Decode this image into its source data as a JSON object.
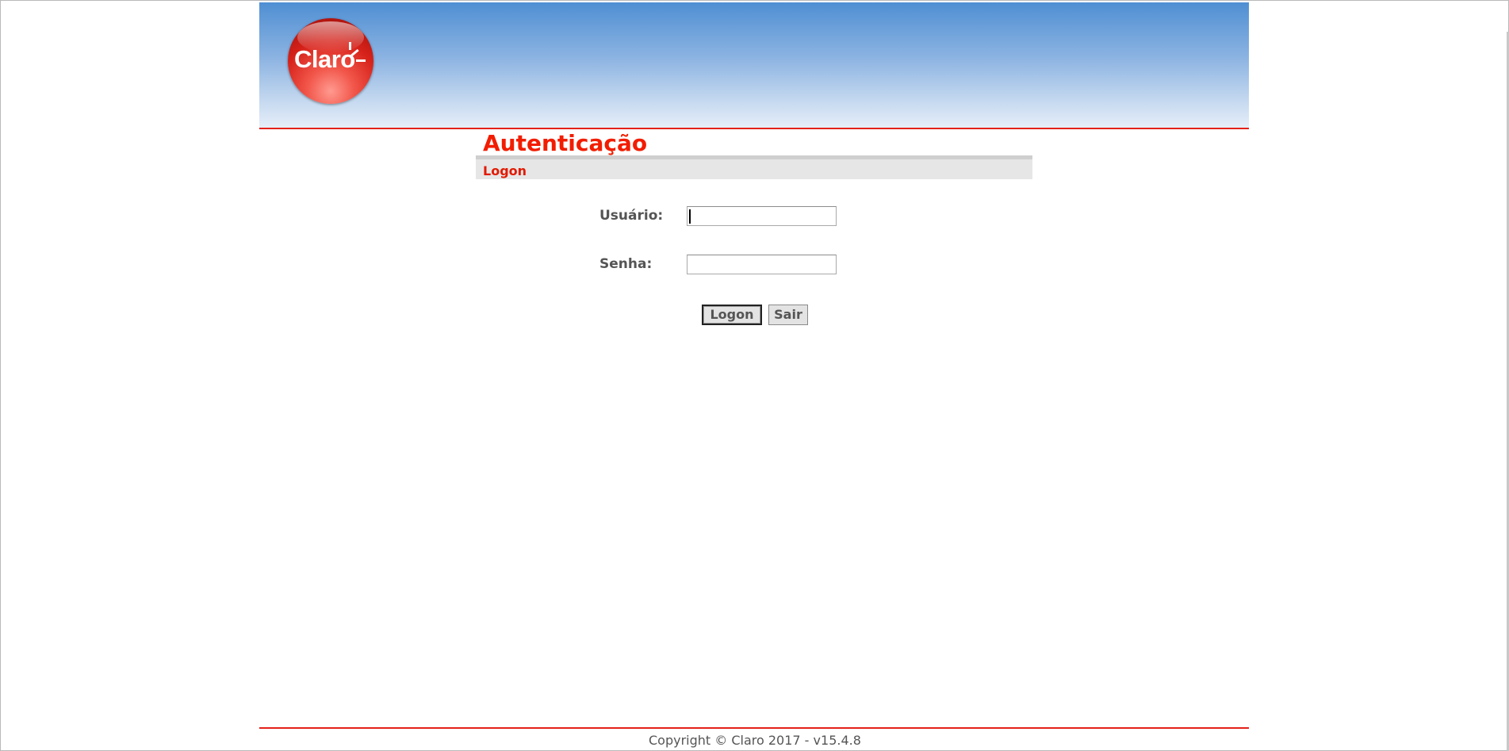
{
  "header": {
    "logo_text": "Claro",
    "accent_color": "#e32119",
    "gradient_top": "#4f8fd3"
  },
  "page": {
    "title": "Autenticação",
    "section_label": "Logon"
  },
  "form": {
    "username_label": "Usuário:",
    "username_value": "",
    "password_label": "Senha:",
    "password_value": "",
    "logon_button": "Logon",
    "exit_button": "Sair"
  },
  "footer": {
    "copyright": "Copyright © Claro 2017 - v15.4.8"
  }
}
